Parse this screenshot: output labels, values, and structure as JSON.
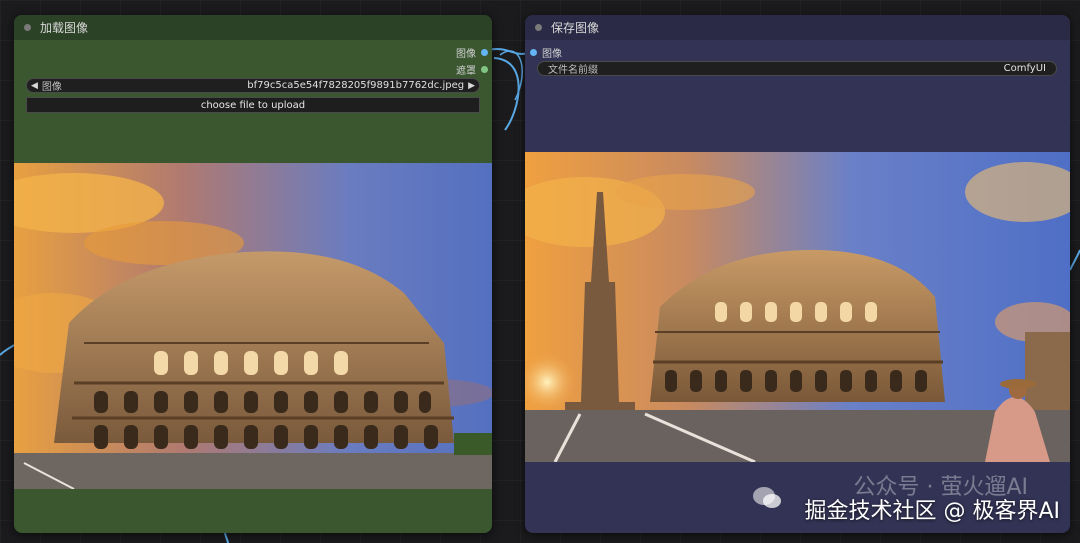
{
  "load_node": {
    "title": "加载图像",
    "outputs": [
      {
        "label": "图像",
        "color": "#64b5f6"
      },
      {
        "label": "遮罩",
        "color": "#81c784"
      }
    ],
    "image_widget": {
      "label": "图像",
      "value": "bf79c5ca5e54f7828205f9891b7762dc.jpeg"
    },
    "upload_button": "choose file to upload",
    "preview": "colosseum-sunset-photo"
  },
  "save_node": {
    "title": "保存图像",
    "inputs": [
      {
        "label": "图像",
        "color": "#64b5f6"
      }
    ],
    "prefix_widget": {
      "label": "文件名前缀",
      "value": "ComfyUI"
    },
    "preview": "colosseum-with-column-and-woman-photo"
  },
  "watermark": {
    "ghost_text": "公众号 · 萤火遛AI",
    "main_text": "掘金技术社区 @ 极客界AI"
  },
  "colors": {
    "load_node_bg": "#3a5730",
    "save_node_bg": "#333355",
    "wire_color": "#5aa9e6"
  }
}
